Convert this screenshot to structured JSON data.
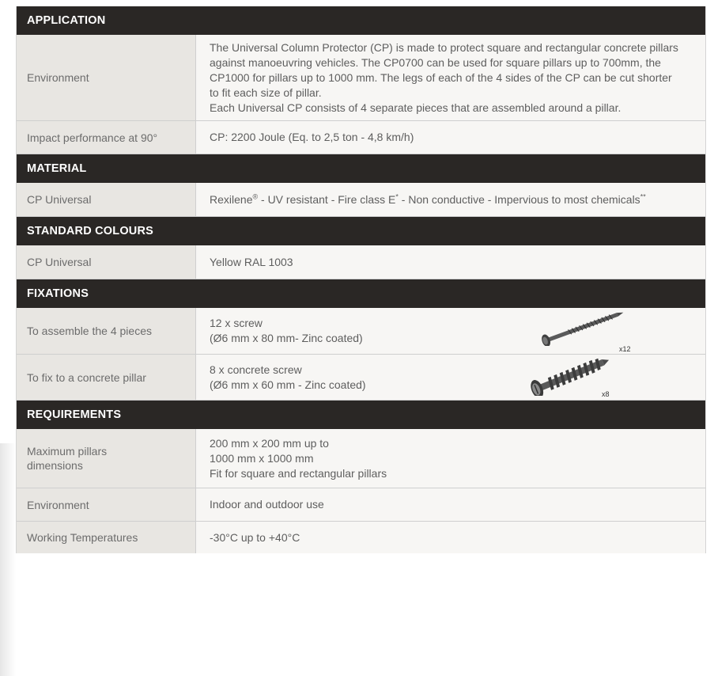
{
  "sections": {
    "application": "APPLICATION",
    "material": "MATERIAL",
    "standard_colours": "STANDARD COLOURS",
    "fixations": "FIXATIONS",
    "requirements": "REQUIREMENTS"
  },
  "application": {
    "environment": {
      "label": "Environment",
      "lines": [
        "The Universal Column Protector (CP) is made to protect square and rectangular concrete pillars",
        "against manoeuvring vehicles. The CP0700 can be used for square pillars up to 700mm, the",
        "CP1000 for pillars up to 1000 mm. The legs of each of the 4 sides of the CP can be cut shorter",
        "to fit each size of pillar.",
        "Each  Universal CP consists of 4 separate pieces that are assembled around a pillar."
      ]
    },
    "impact": {
      "label": "Impact performance at 90°",
      "value": "CP: 2200 Joule (Eq. to 2,5 ton - 4,8 km/h)"
    }
  },
  "material": {
    "label": "CP Universal",
    "v1": "Rexilene",
    "reg": "®",
    "v2": " - UV resistant - Fire class E",
    "star1": "*",
    "v3": " - Non conductive - Impervious to most chemicals",
    "star2": "**"
  },
  "standard_colours": {
    "label": "CP Universal",
    "value": "Yellow RAL 1003"
  },
  "fixations": {
    "assemble": {
      "label": "To assemble the 4 pieces",
      "line1": "12 x screw",
      "line2": "(Ø6 mm x 80 mm- Zinc coated)",
      "qty": "x12",
      "icon": "screw-icon"
    },
    "fix": {
      "label": "To fix to a concrete pillar",
      "line1": "8 x concrete screw",
      "line2": "(Ø6 mm x 60 mm - Zinc coated)",
      "qty": "x8",
      "icon": "concrete-screw-icon"
    }
  },
  "requirements": {
    "dimensions": {
      "label_line1": "Maximum pillars",
      "label_line2": "dimensions",
      "line1": "200 mm x 200 mm up to",
      "line2": "1000 mm x 1000 mm",
      "line3": "Fit for square and rectangular pillars"
    },
    "environment": {
      "label": "Environment",
      "value": "Indoor and outdoor use"
    },
    "temperatures": {
      "label": "Working Temperatures",
      "value": "-30°C up to +40°C"
    }
  },
  "colors": {
    "header_bg": "#2a2725",
    "label_bg": "#e8e6e2",
    "value_bg": "#f7f6f4"
  }
}
